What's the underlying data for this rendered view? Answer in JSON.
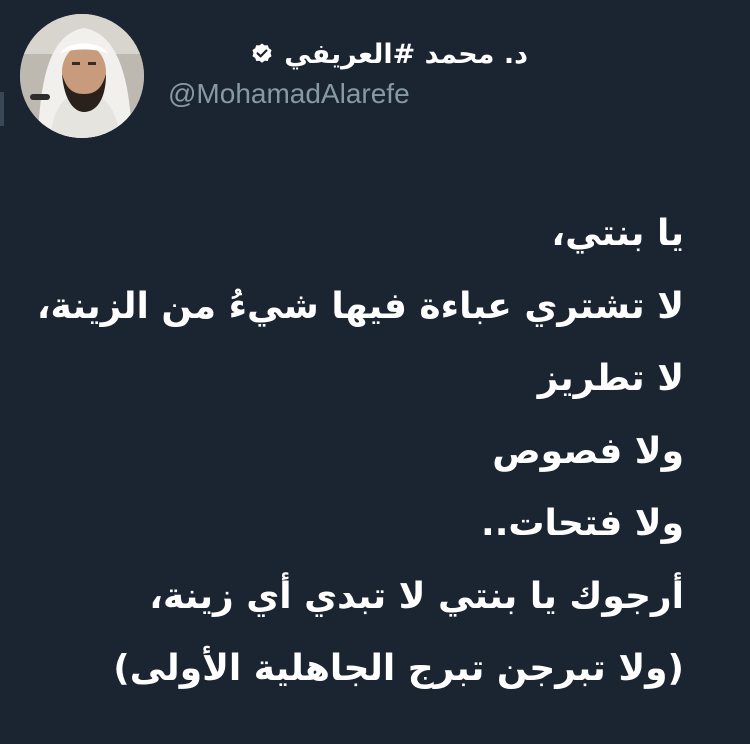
{
  "profile": {
    "display_name": "د. محمد #العريفي",
    "username": "@MohamadAlarefe",
    "verified": true,
    "icons": [
      "avatar",
      "verified-badge-icon"
    ]
  },
  "tweet": {
    "lines": [
      "يا بنتي،",
      "لا تشتري عباءة فيها شيءُ من الزينة،",
      "لا تطريز",
      "ولا فصوص",
      "ولا فتحات..",
      "أرجوك يا بنتي لا تبدي أي زينة،",
      "(ولا تبرجن تبرج الجاهلية الأولى)"
    ]
  },
  "colors": {
    "background": "#1b2532",
    "text": "#ffffff",
    "secondary_text": "#8899a6"
  }
}
